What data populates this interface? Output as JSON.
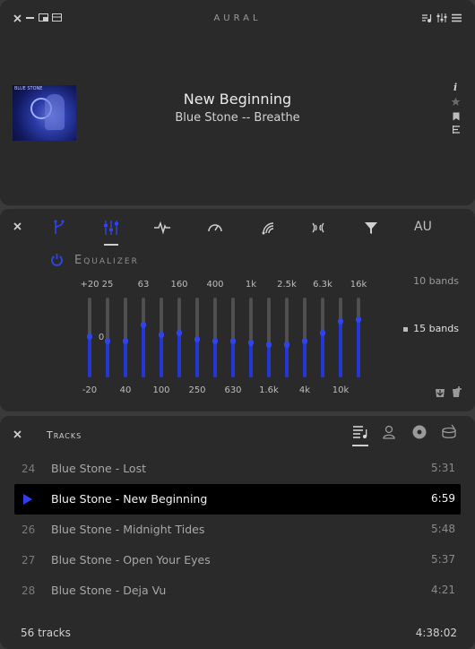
{
  "player": {
    "app_title": "AURAL",
    "album_art_text": "BLUE STONE",
    "track_title": "New Beginning",
    "track_artist_album": "Blue Stone -- Breathe",
    "side_icons": [
      "info-icon",
      "favorite-star-icon",
      "bookmark-icon",
      "lyrics-icon"
    ]
  },
  "effects": {
    "tabs": [
      "master",
      "equalizer",
      "pitch",
      "time",
      "reverb",
      "delay",
      "filter",
      "AU"
    ],
    "au_label": "AU",
    "equalizer_title": "Equalizer",
    "scale": {
      "max": "+20",
      "mid": "0",
      "min": "-20"
    },
    "top_freqs": [
      "25",
      "63",
      "160",
      "400",
      "1k",
      "2.5k",
      "6.3k",
      "16k"
    ],
    "bottom_freqs": [
      "40",
      "100",
      "250",
      "630",
      "1.6k",
      "4k",
      "10k"
    ],
    "band_levels": [
      0.5,
      0.45,
      0.45,
      0.65,
      0.53,
      0.55,
      0.47,
      0.45,
      0.45,
      0.43,
      0.4,
      0.4,
      0.45,
      0.55,
      0.7,
      0.72
    ],
    "band_options": [
      "10 bands",
      "15 bands"
    ],
    "selected_band_option": "15 bands",
    "accent_color": "#2f44f0"
  },
  "playlist": {
    "title": "Tracks",
    "rows": [
      {
        "num": "24",
        "name": "Blue Stone - Lost",
        "duration": "5:31",
        "playing": false
      },
      {
        "num": "",
        "name": "Blue Stone - New Beginning",
        "duration": "6:59",
        "playing": true
      },
      {
        "num": "26",
        "name": "Blue Stone - Midnight Tides",
        "duration": "5:48",
        "playing": false
      },
      {
        "num": "27",
        "name": "Blue Stone - Open Your Eyes",
        "duration": "5:37",
        "playing": false
      },
      {
        "num": "28",
        "name": "Blue Stone - Deja Vu",
        "duration": "4:21",
        "playing": false
      }
    ],
    "track_count": "56 tracks",
    "total_duration": "4:38:02"
  }
}
